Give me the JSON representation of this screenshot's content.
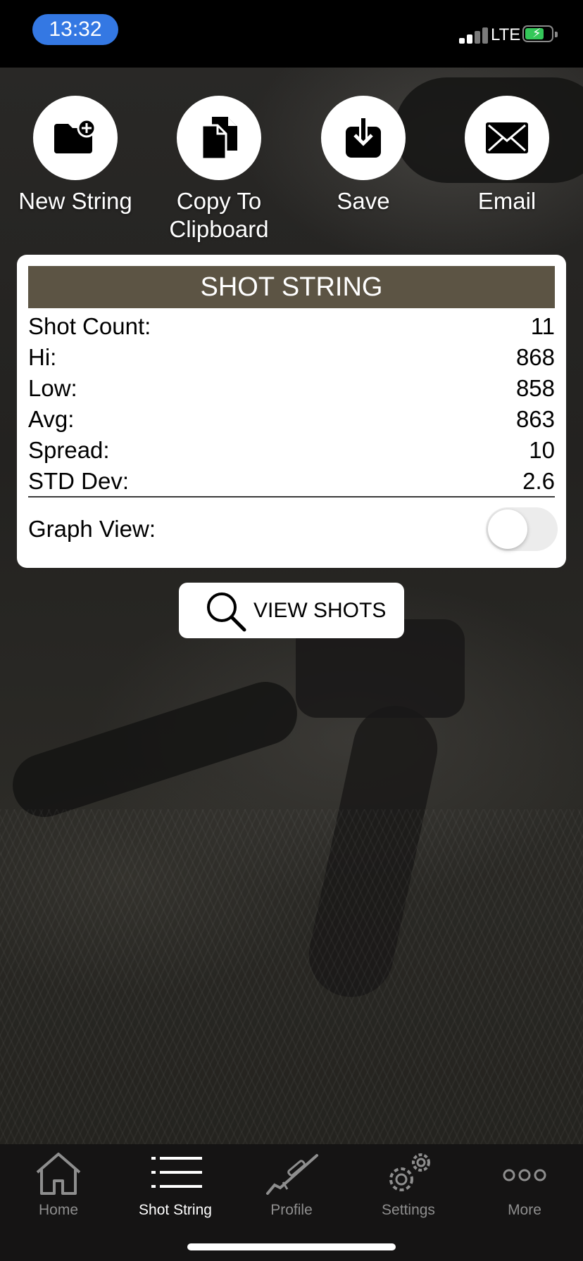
{
  "status_bar": {
    "time": "13:32",
    "network": "LTE"
  },
  "actions": [
    {
      "label": "New String",
      "icon": "new-folder-icon"
    },
    {
      "label": "Copy To\nClipboard",
      "icon": "copy-documents-icon"
    },
    {
      "label": "Save",
      "icon": "download-icon"
    },
    {
      "label": "Email",
      "icon": "envelope-icon"
    }
  ],
  "card": {
    "title": "SHOT STRING",
    "stats": [
      {
        "label": "Shot Count:",
        "value": "11"
      },
      {
        "label": "Hi:",
        "value": "868"
      },
      {
        "label": "Low:",
        "value": "858"
      },
      {
        "label": "Avg:",
        "value": "863"
      },
      {
        "label": "Spread:",
        "value": "10"
      },
      {
        "label": "STD Dev:",
        "value": "2.6"
      }
    ],
    "graph_view_label": "Graph View:",
    "graph_view_on": false
  },
  "view_shots": {
    "label": "VIEW SHOTS",
    "icon": "search-icon"
  },
  "tabs": [
    {
      "label": "Home",
      "icon": "home-icon",
      "active": false
    },
    {
      "label": "Shot String",
      "icon": "list-icon",
      "active": true
    },
    {
      "label": "Profile",
      "icon": "rifle-icon",
      "active": false
    },
    {
      "label": "Settings",
      "icon": "gears-icon",
      "active": false
    },
    {
      "label": "More",
      "icon": "more-dots-icon",
      "active": false
    }
  ],
  "colors": {
    "header_bg": "#5c5444",
    "time_pill": "#3478e3",
    "battery_fill": "#34c759",
    "tab_inactive": "#8e8e8e",
    "tab_active": "#ffffff"
  }
}
